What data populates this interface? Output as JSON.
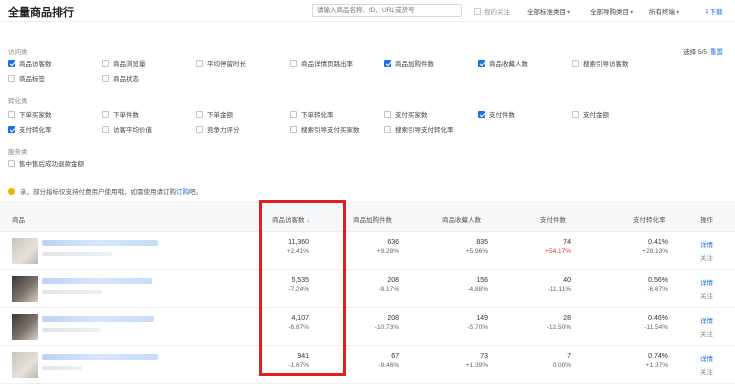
{
  "header": {
    "title": "全量商品排行",
    "search_placeholder": "请输入商品名称、ID、URL或货号",
    "my_follow_label": "我的关注",
    "dropdowns": [
      "全部标准类目",
      "全部导购类目",
      "所有终端"
    ],
    "download_label": "下载"
  },
  "metric_selector": {
    "selected_count": "选择 5/5",
    "reset_label": "重置",
    "groups": [
      {
        "label": "访问类",
        "options": [
          {
            "label": "商品访客数",
            "checked": true
          },
          {
            "label": "商品浏览量",
            "checked": false
          },
          {
            "label": "平均停留时长",
            "checked": false
          },
          {
            "label": "商品详情页跳出率",
            "checked": false
          },
          {
            "label": "商品加购件数",
            "checked": true
          },
          {
            "label": "商品收藏人数",
            "checked": true
          },
          {
            "label": "搜索引导访客数",
            "checked": false
          },
          {
            "label": "商品标签",
            "checked": false
          },
          {
            "label": "商品状态",
            "checked": false
          }
        ]
      },
      {
        "label": "转化类",
        "options": [
          {
            "label": "下单买家数",
            "checked": false
          },
          {
            "label": "下单件数",
            "checked": false
          },
          {
            "label": "下单金额",
            "checked": false
          },
          {
            "label": "下单转化率",
            "checked": false
          },
          {
            "label": "支付买家数",
            "checked": false
          },
          {
            "label": "支付件数",
            "checked": true
          },
          {
            "label": "支付金额",
            "checked": false
          },
          {
            "label": "支付转化率",
            "checked": true
          },
          {
            "label": "访客平均价值",
            "checked": false
          },
          {
            "label": "竞争力评分",
            "checked": false
          },
          {
            "label": "搜索引导支付买家数",
            "checked": false
          },
          {
            "label": "搜索引导支付转化率",
            "checked": false
          }
        ]
      },
      {
        "label": "服务类",
        "options": [
          {
            "label": "售中售后成功退款金额",
            "checked": false
          }
        ]
      }
    ]
  },
  "notice": {
    "text": "亲，部分指标仅支持付费用户使用哦，如需使用请订购",
    "link": "订购",
    "suffix": "吧。"
  },
  "table": {
    "columns": [
      "商品",
      "商品访客数",
      "商品加购件数",
      "商品收藏人数",
      "支付件数",
      "支付转化率",
      "操作"
    ],
    "sort_indicator": "↓",
    "action_detail": "详情",
    "action_follow": "关注",
    "rows": [
      {
        "visitors": "11,360",
        "visitors_change": "+2.41%",
        "cart": "636",
        "cart_change": "+9.28%",
        "fav": "835",
        "fav_change": "+5.96%",
        "pay_items": "74",
        "pay_items_change": "+54.17%",
        "conv": "0.41%",
        "conv_change": "+28.13%"
      },
      {
        "visitors": "5,535",
        "visitors_change": "-7.24%",
        "cart": "208",
        "cart_change": "-9.17%",
        "fav": "156",
        "fav_change": "-4.88%",
        "pay_items": "40",
        "pay_items_change": "-11.11%",
        "conv": "0.56%",
        "conv_change": "-6.67%"
      },
      {
        "visitors": "4,107",
        "visitors_change": "-6.87%",
        "cart": "208",
        "cart_change": "-10.73%",
        "fav": "149",
        "fav_change": "-5.70%",
        "pay_items": "28",
        "pay_items_change": "-12.50%",
        "conv": "0.46%",
        "conv_change": "-11.54%"
      },
      {
        "visitors": "941",
        "visitors_change": "-1.67%",
        "cart": "67",
        "cart_change": "-9.46%",
        "fav": "73",
        "fav_change": "+1.39%",
        "pay_items": "7",
        "pay_items_change": "0.00%",
        "conv": "0.74%",
        "conv_change": "+1.37%"
      }
    ]
  },
  "colors": {
    "accent": "#1a73e8",
    "highlight_border": "#e02020",
    "positive_change": "#e23b3b"
  }
}
